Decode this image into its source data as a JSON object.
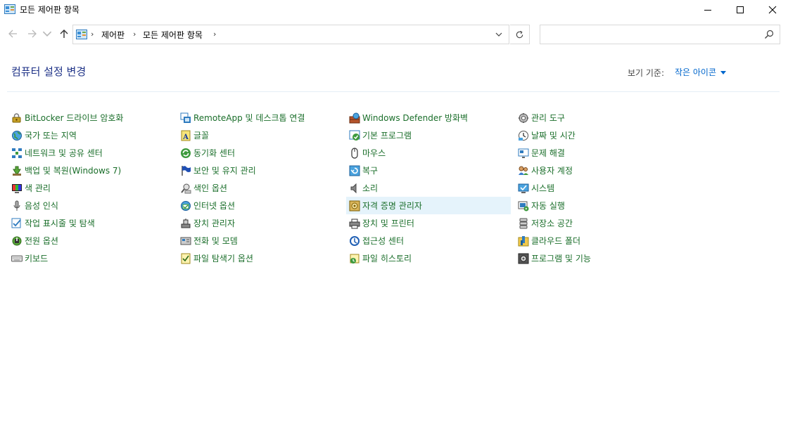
{
  "window": {
    "title": "모든 제어판 항목"
  },
  "nav": {
    "breadcrumb": [
      "제어판",
      "모든 제어판 항목"
    ],
    "search_value": "",
    "search_placeholder": ""
  },
  "header": {
    "title": "컴퓨터 설정 변경",
    "view_by_label": "보기 기준:",
    "view_by_value": "작은 아이콘"
  },
  "colors": {
    "item_text": "#1a6e2a",
    "title_text": "#1e3287",
    "link": "#0066cc",
    "hover_bg": "#e5f3fb"
  },
  "columns": [
    [
      {
        "label": "BitLocker 드라이브 암호화",
        "icon": "bitlocker-icon"
      },
      {
        "label": "국가 또는 지역",
        "icon": "globe-icon"
      },
      {
        "label": "네트워크 및 공유 센터",
        "icon": "network-icon"
      },
      {
        "label": "백업 및 복원(Windows 7)",
        "icon": "backup-icon"
      },
      {
        "label": "색 관리",
        "icon": "color-monitor-icon"
      },
      {
        "label": "음성 인식",
        "icon": "microphone-icon"
      },
      {
        "label": "작업 표시줄 및 탐색",
        "icon": "taskbar-icon"
      },
      {
        "label": "전원 옵션",
        "icon": "power-icon"
      },
      {
        "label": "키보드",
        "icon": "keyboard-icon"
      }
    ],
    [
      {
        "label": "RemoteApp 및 데스크톱 연결",
        "icon": "remoteapp-icon"
      },
      {
        "label": "글꼴",
        "icon": "font-icon"
      },
      {
        "label": "동기화 센터",
        "icon": "sync-icon"
      },
      {
        "label": "보안 및 유지 관리",
        "icon": "flag-icon"
      },
      {
        "label": "색인 옵션",
        "icon": "indexing-icon"
      },
      {
        "label": "인터넷 옵션",
        "icon": "internet-icon"
      },
      {
        "label": "장치 관리자",
        "icon": "device-manager-icon"
      },
      {
        "label": "전화 및 모뎀",
        "icon": "phone-icon"
      },
      {
        "label": "파일 탐색기 옵션",
        "icon": "folder-options-icon"
      }
    ],
    [
      {
        "label": "Windows Defender 방화벽",
        "icon": "firewall-icon"
      },
      {
        "label": "기본 프로그램",
        "icon": "default-programs-icon"
      },
      {
        "label": "마우스",
        "icon": "mouse-icon"
      },
      {
        "label": "복구",
        "icon": "recovery-icon"
      },
      {
        "label": "소리",
        "icon": "speaker-icon"
      },
      {
        "label": "자격 증명 관리자",
        "icon": "credential-icon",
        "hover": true
      },
      {
        "label": "장치 및 프린터",
        "icon": "printer-icon"
      },
      {
        "label": "접근성 센터",
        "icon": "accessibility-icon"
      },
      {
        "label": "파일 히스토리",
        "icon": "file-history-icon"
      }
    ],
    [
      {
        "label": "관리 도구",
        "icon": "admin-tools-icon"
      },
      {
        "label": "날짜 및 시간",
        "icon": "clock-icon"
      },
      {
        "label": "문제 해결",
        "icon": "troubleshoot-icon"
      },
      {
        "label": "사용자 계정",
        "icon": "users-icon"
      },
      {
        "label": "시스템",
        "icon": "system-icon"
      },
      {
        "label": "자동 실행",
        "icon": "autoplay-icon"
      },
      {
        "label": "저장소 공간",
        "icon": "storage-icon"
      },
      {
        "label": "클라우드 폴더",
        "icon": "cloud-folder-icon"
      },
      {
        "label": "프로그램 및 기능",
        "icon": "programs-icon"
      }
    ]
  ]
}
